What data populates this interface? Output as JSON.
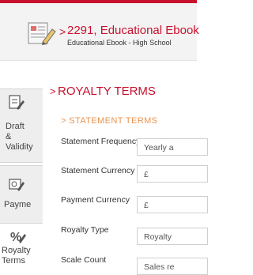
{
  "header": {
    "title": "2291, Educational Ebook",
    "subtitle": "Educational Ebook - High School",
    "arrow": ">"
  },
  "sidebar": {
    "items": [
      {
        "label": "Draft\n&\nValidity",
        "icon": "checklist-pencil-icon"
      },
      {
        "label": "Payme",
        "icon": "payment-pencil-icon"
      },
      {
        "label": "Royalty\nTerms",
        "icon": "percent-pencil-icon"
      }
    ]
  },
  "panel": {
    "arrow": ">",
    "title": "ROYALTY TERMS",
    "section_title": "> STATEMENT TERMS",
    "rows": [
      {
        "label": "Statement Frequency",
        "value": "Yearly a"
      },
      {
        "label": "Statement Currency",
        "value": "£"
      },
      {
        "label": "Payment Currency",
        "value": "£"
      },
      {
        "label": "Royalty Type",
        "value": "Royalty"
      },
      {
        "label": "Scale Count",
        "value": "Sales re"
      }
    ]
  },
  "colors": {
    "accent": "#c8102e",
    "section_orange": "#e8944f",
    "sidebar_bg": "#eeeeee",
    "header_bg": "#f3f3f3"
  }
}
